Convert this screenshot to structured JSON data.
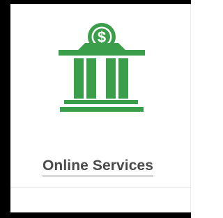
{
  "card": {
    "icon": "bank-dollar-icon",
    "title": "Online Services"
  },
  "colors": {
    "accent": "#3a9e4b",
    "text": "#4a4a4a",
    "frame": "#000000"
  }
}
